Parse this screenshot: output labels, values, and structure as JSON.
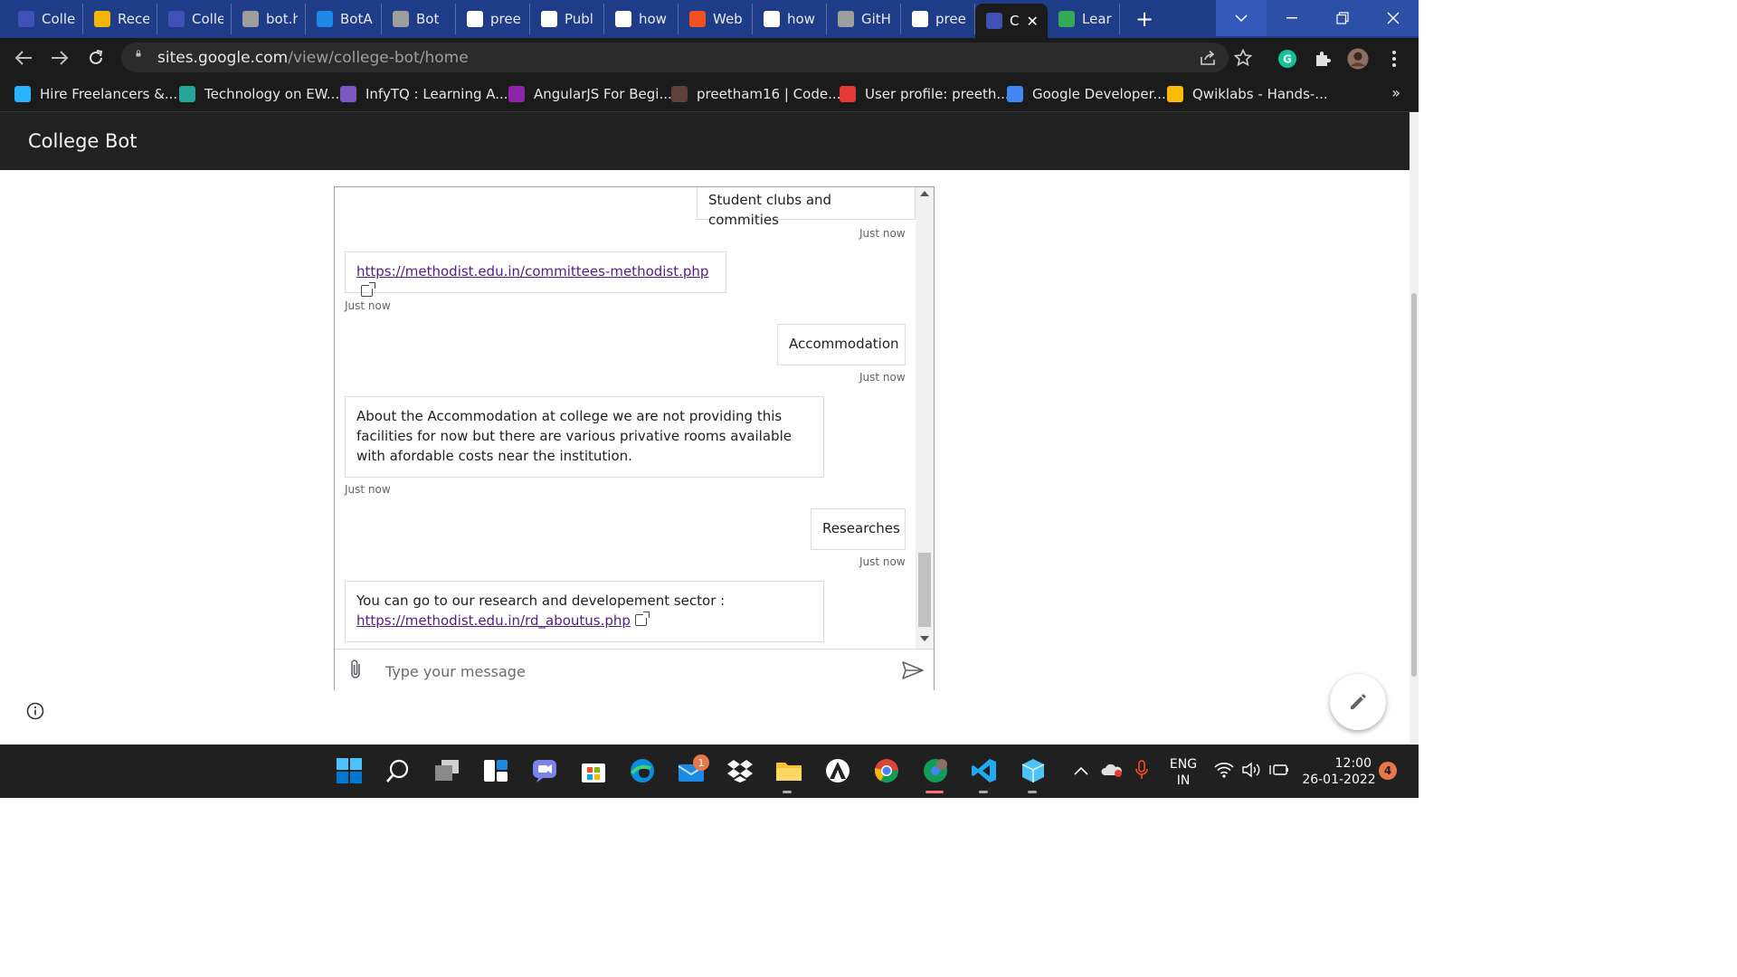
{
  "browser": {
    "tabs": [
      {
        "label": "Colle",
        "icon": "google-sites-icon",
        "color": "#3f51b5"
      },
      {
        "label": "Rece",
        "icon": "google-drive-icon",
        "color": "#f4b400"
      },
      {
        "label": "Colle",
        "icon": "google-sites-icon",
        "color": "#3f51b5"
      },
      {
        "label": "bot.h",
        "icon": "globe-icon",
        "color": "#9e9e9e"
      },
      {
        "label": "BotA",
        "icon": "azure-icon",
        "color": "#1e88e5"
      },
      {
        "label": "Bot",
        "icon": "globe-icon",
        "color": "#9e9e9e"
      },
      {
        "label": "pree",
        "icon": "github-icon",
        "color": "#ffffff"
      },
      {
        "label": "Publ",
        "icon": "at-icon",
        "color": "#ffffff"
      },
      {
        "label": "how",
        "icon": "google-icon",
        "color": "#ffffff"
      },
      {
        "label": "Web",
        "icon": "microsoft-icon",
        "color": "#f25022"
      },
      {
        "label": "how",
        "icon": "google-icon",
        "color": "#ffffff"
      },
      {
        "label": "GitH",
        "icon": "globe-icon",
        "color": "#9e9e9e"
      },
      {
        "label": "pree",
        "icon": "github-icon",
        "color": "#ffffff"
      },
      {
        "label": "C",
        "icon": "google-sites-icon",
        "color": "#3f51b5",
        "active": true
      },
      {
        "label": "Learn",
        "icon": "play-icon",
        "color": "#34a853"
      }
    ],
    "url_host": "sites.google.com",
    "url_path": "/view/college-bot/home",
    "bookmarks": [
      {
        "label": "Hire Freelancers &...",
        "icon": "freelancer-icon",
        "color": "#29b2fe"
      },
      {
        "label": "Technology on EW...",
        "icon": "ew-icon",
        "color": "#26a69a"
      },
      {
        "label": "InfyTQ : Learning A...",
        "icon": "infytq-icon",
        "color": "#7e57c2"
      },
      {
        "label": "AngularJS For Begi...",
        "icon": "udemy-icon",
        "color": "#8e24aa"
      },
      {
        "label": "preetham16 | Code...",
        "icon": "codechef-icon",
        "color": "#5d4037"
      },
      {
        "label": "User profile: preeth...",
        "icon": "hackerearth-icon",
        "color": "#e53935"
      },
      {
        "label": "Google Developer...",
        "icon": "google-dev-icon",
        "color": "#4285f4"
      },
      {
        "label": "Qwiklabs - Hands-...",
        "icon": "qwiklabs-icon",
        "color": "#fbbc05"
      }
    ]
  },
  "site": {
    "title": "College Bot"
  },
  "chat": {
    "messages": [
      {
        "from": "user",
        "text": "Student clubs and commities",
        "time": "Just now"
      },
      {
        "from": "bot",
        "link": "https://methodist.edu.in/committees-methodist.php",
        "time": "Just now"
      },
      {
        "from": "user",
        "text": "Accommodation",
        "time": "Just now"
      },
      {
        "from": "bot",
        "text": "About the Accommodation at college we are not providing this facilities for now but there are various privative rooms available with afordable costs near the institution.",
        "time": "Just now"
      },
      {
        "from": "user",
        "text": "Researches",
        "time": "Just now"
      },
      {
        "from": "bot",
        "text": "You can go to our research and developement sector :",
        "link": "https://methodist.edu.in/rd_aboutus.php",
        "time": "Just now"
      }
    ],
    "input_placeholder": "Type your message"
  },
  "taskbar": {
    "mail_badge": "1",
    "lang_line1": "ENG",
    "lang_line2": "IN",
    "time": "12:00",
    "date": "26-01-2022",
    "notifications": "4"
  }
}
